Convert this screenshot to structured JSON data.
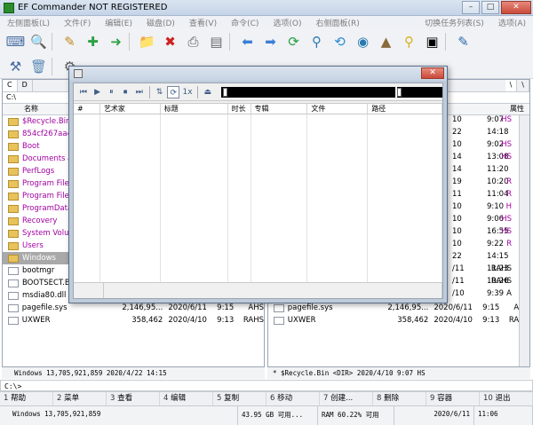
{
  "window": {
    "title": "EF Commander NOT REGISTERED"
  },
  "menu": [
    "左侧面板(L)",
    "文件(F)",
    "编辑(E)",
    "磁盘(D)",
    "查看(V)",
    "命令(C)",
    "选项(O)",
    "右侧面板(R)",
    "切换任务列表(S)",
    "选项(A)"
  ],
  "left_panel": {
    "drive_tabs": [
      "C",
      "D"
    ],
    "path": "C:\\",
    "columns": {
      "name": "名称"
    },
    "rows": [
      {
        "name": "$Recycle.Bin",
        "type": "folder",
        "color": "purple"
      },
      {
        "name": "854cf267aa44f",
        "type": "folder",
        "color": "purple"
      },
      {
        "name": "Boot",
        "type": "folder",
        "color": "purple"
      },
      {
        "name": "Documents and",
        "type": "folder",
        "color": "purple"
      },
      {
        "name": "PerfLogs",
        "type": "folder",
        "color": "purple"
      },
      {
        "name": "Program Files",
        "type": "folder",
        "color": "purple"
      },
      {
        "name": "Program Files",
        "type": "folder",
        "color": "purple"
      },
      {
        "name": "ProgramData",
        "type": "folder",
        "color": "purple"
      },
      {
        "name": "Recovery",
        "type": "folder",
        "color": "purple"
      },
      {
        "name": "System Volum",
        "type": "folder",
        "color": "purple"
      },
      {
        "name": "Users",
        "type": "folder",
        "color": "purple"
      },
      {
        "name": "Windows",
        "type": "folder",
        "color": "purple",
        "selected": true
      },
      {
        "name": "bootmgr",
        "type": "file",
        "color": "black"
      },
      {
        "name": "BOOTSECT.BA",
        "type": "file",
        "color": "black"
      },
      {
        "name": "msdia80.dll",
        "type": "file",
        "color": "black"
      },
      {
        "name": "pagefile.sys",
        "type": "file",
        "color": "black",
        "size": "2,146,95...",
        "date": "2020/6/11",
        "time": "9:15",
        "attr": "AHS"
      },
      {
        "name": "UXWER",
        "type": "file",
        "color": "black",
        "size": "358,462",
        "date": "2020/4/10",
        "time": "9:13",
        "attr": "RAHS"
      }
    ],
    "status": "Windows     13,705,921,859  2020/4/22    14:15"
  },
  "right_panel": {
    "columns": {
      "attr": "属性"
    },
    "rows": [
      {
        "date": "10",
        "time": "9:07",
        "attr": "HS"
      },
      {
        "date": "22",
        "time": "14:18",
        "attr": ""
      },
      {
        "date": "10",
        "time": "9:02",
        "attr": "HS"
      },
      {
        "date": "14",
        "time": "13:08",
        "attr": "HS"
      },
      {
        "date": "14",
        "time": "11:20",
        "attr": ""
      },
      {
        "date": "19",
        "time": "10:20",
        "attr": "R"
      },
      {
        "date": "11",
        "time": "11:04",
        "attr": "R"
      },
      {
        "date": "10",
        "time": "9:10",
        "attr": "H"
      },
      {
        "date": "10",
        "time": "9:06",
        "attr": "HS"
      },
      {
        "date": "10",
        "time": "16:55",
        "attr": "HS"
      },
      {
        "date": "10",
        "time": "9:22",
        "attr": "R"
      },
      {
        "date": "22",
        "time": "14:15",
        "attr": ""
      },
      {
        "date": "/11",
        "time": "11:23",
        "attr": "RAHS"
      },
      {
        "date": "/11",
        "time": "10:26",
        "attr": "RAHS"
      },
      {
        "date": "/10",
        "time": "9:39",
        "attr": "A"
      }
    ],
    "files": [
      {
        "name": "pagefile.sys",
        "size": "2,146,95...",
        "date": "2020/6/11",
        "time": "9:15",
        "attr": "AHS"
      },
      {
        "name": "UXWER",
        "size": "358,462",
        "date": "2020/4/10",
        "time": "9:13",
        "attr": "RAHS"
      }
    ],
    "status": "* $Recycle.Bin   <DIR>  2020/4/10   9:07  HS"
  },
  "command_line": "C:\\>",
  "function_keys": [
    {
      "num": "1",
      "label": "帮助"
    },
    {
      "num": "2",
      "label": "菜单"
    },
    {
      "num": "3",
      "label": "查看"
    },
    {
      "num": "4",
      "label": "编辑"
    },
    {
      "num": "5",
      "label": "复制"
    },
    {
      "num": "6",
      "label": "移动"
    },
    {
      "num": "7",
      "label": "创建..."
    },
    {
      "num": "8",
      "label": "删除"
    },
    {
      "num": "9",
      "label": "容器"
    },
    {
      "num": "10",
      "label": "退出"
    }
  ],
  "bottom_status": {
    "left": "Windows      13,705,921,859",
    "disk": "43.95 GB 可用...",
    "ram": "RAM 60.22% 可用",
    "date": "2020/6/11",
    "time": "11:06"
  },
  "player": {
    "columns": [
      "#",
      "艺术家",
      "标题",
      "时长",
      "专辑",
      "文件",
      "路径"
    ],
    "repeat_label": "1x",
    "position_fraction": 0.0,
    "volume_fraction": 0.0
  }
}
